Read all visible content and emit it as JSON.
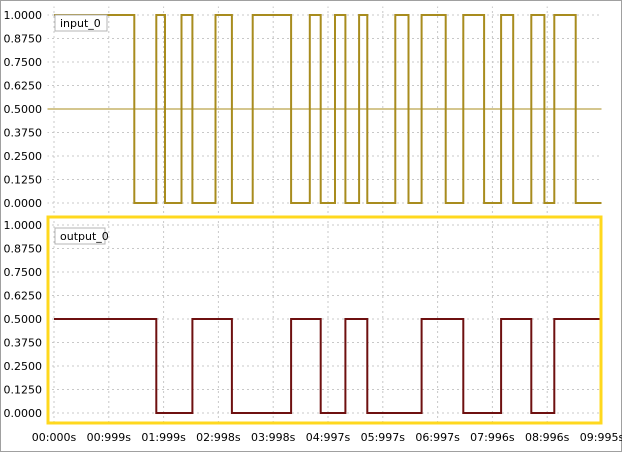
{
  "scope": {
    "time_axis": {
      "ticks": [
        "00:000s",
        "00:999s",
        "01:999s",
        "02:998s",
        "03:998s",
        "04:997s",
        "05:997s",
        "06:997s",
        "07:996s",
        "08:996s",
        "09:995s"
      ],
      "range": [
        0,
        9.995
      ]
    },
    "channels": [
      {
        "id": "input",
        "name": "input_0",
        "color": "#a88c1e",
        "border_color": "#ffffff",
        "selected": false,
        "y_ticks": [
          "1.0000",
          "0.8750",
          "0.7500",
          "0.6250",
          "0.5000",
          "0.3750",
          "0.2500",
          "0.1250",
          "0.0000"
        ],
        "y_range": [
          0,
          1
        ],
        "reference_level": 0.5
      },
      {
        "id": "output",
        "name": "output_0",
        "color": "#6e1010",
        "border_color": "#ffd81e",
        "selected": true,
        "y_ticks": [
          "1.0000",
          "0.8750",
          "0.7500",
          "0.6250",
          "0.5000",
          "0.3750",
          "0.2500",
          "0.1250",
          "0.0000"
        ],
        "y_range": [
          0,
          1
        ],
        "reference_level": null
      }
    ]
  },
  "chart_data": [
    {
      "type": "line",
      "title": "",
      "series": [
        {
          "name": "input_0",
          "x": [
            0,
            1.465,
            1.465,
            1.865,
            1.865,
            2.025,
            2.025,
            2.325,
            2.325,
            2.525,
            2.525,
            2.945,
            2.945,
            3.245,
            3.245,
            3.625,
            3.625,
            4.325,
            4.325,
            4.665,
            4.665,
            4.865,
            4.865,
            5.125,
            5.125,
            5.315,
            5.315,
            5.565,
            5.565,
            5.715,
            5.715,
            6.225,
            6.225,
            6.465,
            6.465,
            6.705,
            6.705,
            7.145,
            7.145,
            7.465,
            7.465,
            7.845,
            7.845,
            8.155,
            8.155,
            8.375,
            8.375,
            8.705,
            8.705,
            8.945,
            8.945,
            9.125,
            9.125,
            9.515,
            9.515,
            9.995
          ],
          "y": [
            1,
            1,
            0,
            0,
            1,
            1,
            0,
            0,
            1,
            1,
            0,
            0,
            1,
            1,
            0,
            0,
            1,
            1,
            0,
            0,
            1,
            1,
            0,
            0,
            1,
            1,
            0,
            0,
            1,
            1,
            0,
            0,
            1,
            1,
            0,
            0,
            1,
            1,
            0,
            0,
            1,
            1,
            0,
            0,
            1,
            1,
            0,
            0,
            1,
            1,
            0,
            0,
            1,
            1,
            0,
            0
          ]
        }
      ],
      "xlim": [
        0,
        9.995
      ],
      "ylim": [
        0,
        1
      ],
      "grid": true,
      "legend": "top-left"
    },
    {
      "type": "line",
      "title": "",
      "series": [
        {
          "name": "output_0",
          "x": [
            0,
            1.865,
            1.865,
            2.525,
            2.525,
            3.245,
            3.245,
            4.325,
            4.325,
            4.865,
            4.865,
            5.315,
            5.315,
            5.715,
            5.715,
            6.705,
            6.705,
            7.465,
            7.465,
            8.155,
            8.155,
            8.705,
            8.705,
            9.125,
            9.125,
            9.995
          ],
          "y": [
            0.5,
            0.5,
            0,
            0,
            0.5,
            0.5,
            0,
            0,
            0.5,
            0.5,
            0,
            0,
            0.5,
            0.5,
            0,
            0,
            0.5,
            0.5,
            0,
            0,
            0.5,
            0.5,
            0,
            0,
            0.5,
            0.5
          ]
        }
      ],
      "xlim": [
        0,
        9.995
      ],
      "ylim": [
        0,
        1
      ],
      "grid": true,
      "legend": "top-left"
    }
  ]
}
